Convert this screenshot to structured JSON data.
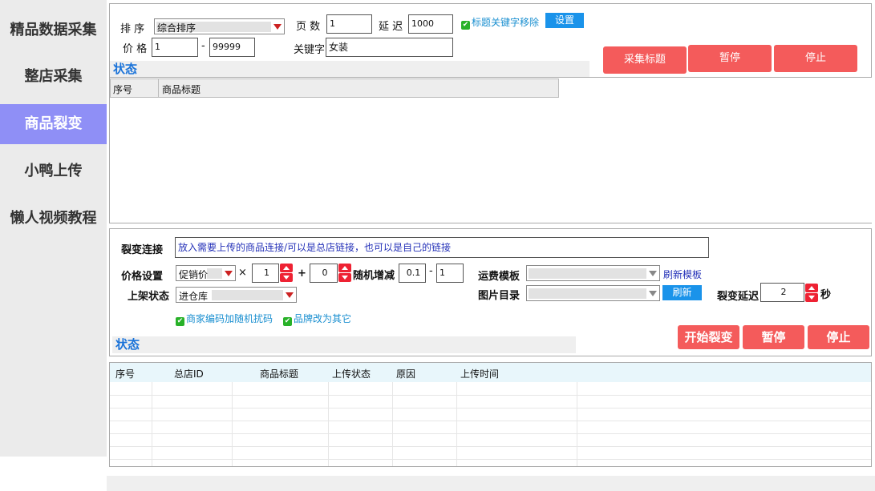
{
  "sidebar": {
    "items": [
      {
        "label": "精品数据采集"
      },
      {
        "label": "整店采集"
      },
      {
        "label": "商品裂变"
      },
      {
        "label": "小鸭上传"
      },
      {
        "label": "懒人视频教程"
      }
    ]
  },
  "collect": {
    "sort_label": "排 序",
    "sort_value": "综合排序",
    "pages_label": "页 数",
    "pages_value": "1",
    "delay_label": "延 迟",
    "delay_value": "1000",
    "remove_kw_label": "标题关键字移除",
    "settings_btn": "设置",
    "price_label": "价 格",
    "price_min": "1",
    "price_dash": "-",
    "price_max": "99999",
    "keyword_label": "关键字",
    "keyword_value": "女装",
    "collect_title_btn": "采集标题",
    "pause_btn": "暂停",
    "stop_btn": "停止",
    "status_title": "状态",
    "columns": [
      "序号",
      "商品标题"
    ]
  },
  "fission": {
    "link_label": "裂变连接",
    "link_value": "放入需要上传的商品连接/可以是总店链接，也可以是自己的链接",
    "price_setting_label": "价格设置",
    "price_mode": "促销价",
    "multiply_sign": "×",
    "multiplier": "1",
    "plus_sign": "+",
    "addend": "0",
    "random_label": "随机增减",
    "random_min": "0.1",
    "random_dash": "-",
    "random_max": "1",
    "shipping_label": "运费模板",
    "refresh_template": "刷新模板",
    "listing_label": "上架状态",
    "listing_value": "进仓库",
    "image_dir_label": "图片目录",
    "refresh_btn": "刷新",
    "fission_delay_label": "裂变延迟",
    "fission_delay_value": "2",
    "seconds_unit": "秒",
    "check_random_code": "商家编码加随机扰码",
    "check_brand": "品牌改为其它",
    "start_btn": "开始裂变",
    "pause_btn": "暂停",
    "stop_btn": "停止",
    "status_title": "状态",
    "columns": [
      "序号",
      "总店ID",
      "商品标题",
      "上传状态",
      "原因",
      "上传时间"
    ]
  },
  "colors": {
    "accent_red": "#f45b5b",
    "accent_blue": "#1a93ea",
    "nav_active": "#8f8ff6"
  }
}
